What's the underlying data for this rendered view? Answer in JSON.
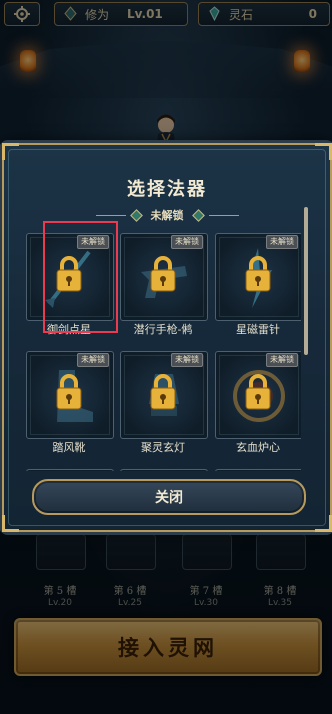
{
  "top_bar": {
    "level_label": "修为",
    "level_value": "Lv.01",
    "gem_label": "灵石",
    "gem_value": "0"
  },
  "slots": [
    {
      "name": "第 5 槽",
      "level": "Lv.20"
    },
    {
      "name": "第 6 槽",
      "level": "Lv.25"
    },
    {
      "name": "第 7 槽",
      "level": "Lv.30"
    },
    {
      "name": "第 8 槽",
      "level": "Lv.35"
    }
  ],
  "enter_button": "接入灵网",
  "modal": {
    "title": "选择法器",
    "section_label": "未解锁",
    "close_label": "关闭",
    "locked_badge": "未解锁",
    "items": [
      {
        "name": "御剑点星"
      },
      {
        "name": "潜行手枪-鸺"
      },
      {
        "name": "星磁雷针"
      },
      {
        "name": "踏风靴"
      },
      {
        "name": "聚灵玄灯"
      },
      {
        "name": "玄血炉心"
      },
      {
        "name": ""
      },
      {
        "name": ""
      },
      {
        "name": ""
      }
    ]
  },
  "colors": {
    "accent_gold": "#b79a5e",
    "highlight": "#ec3b4e",
    "lock_gold": "#e6b23a"
  }
}
